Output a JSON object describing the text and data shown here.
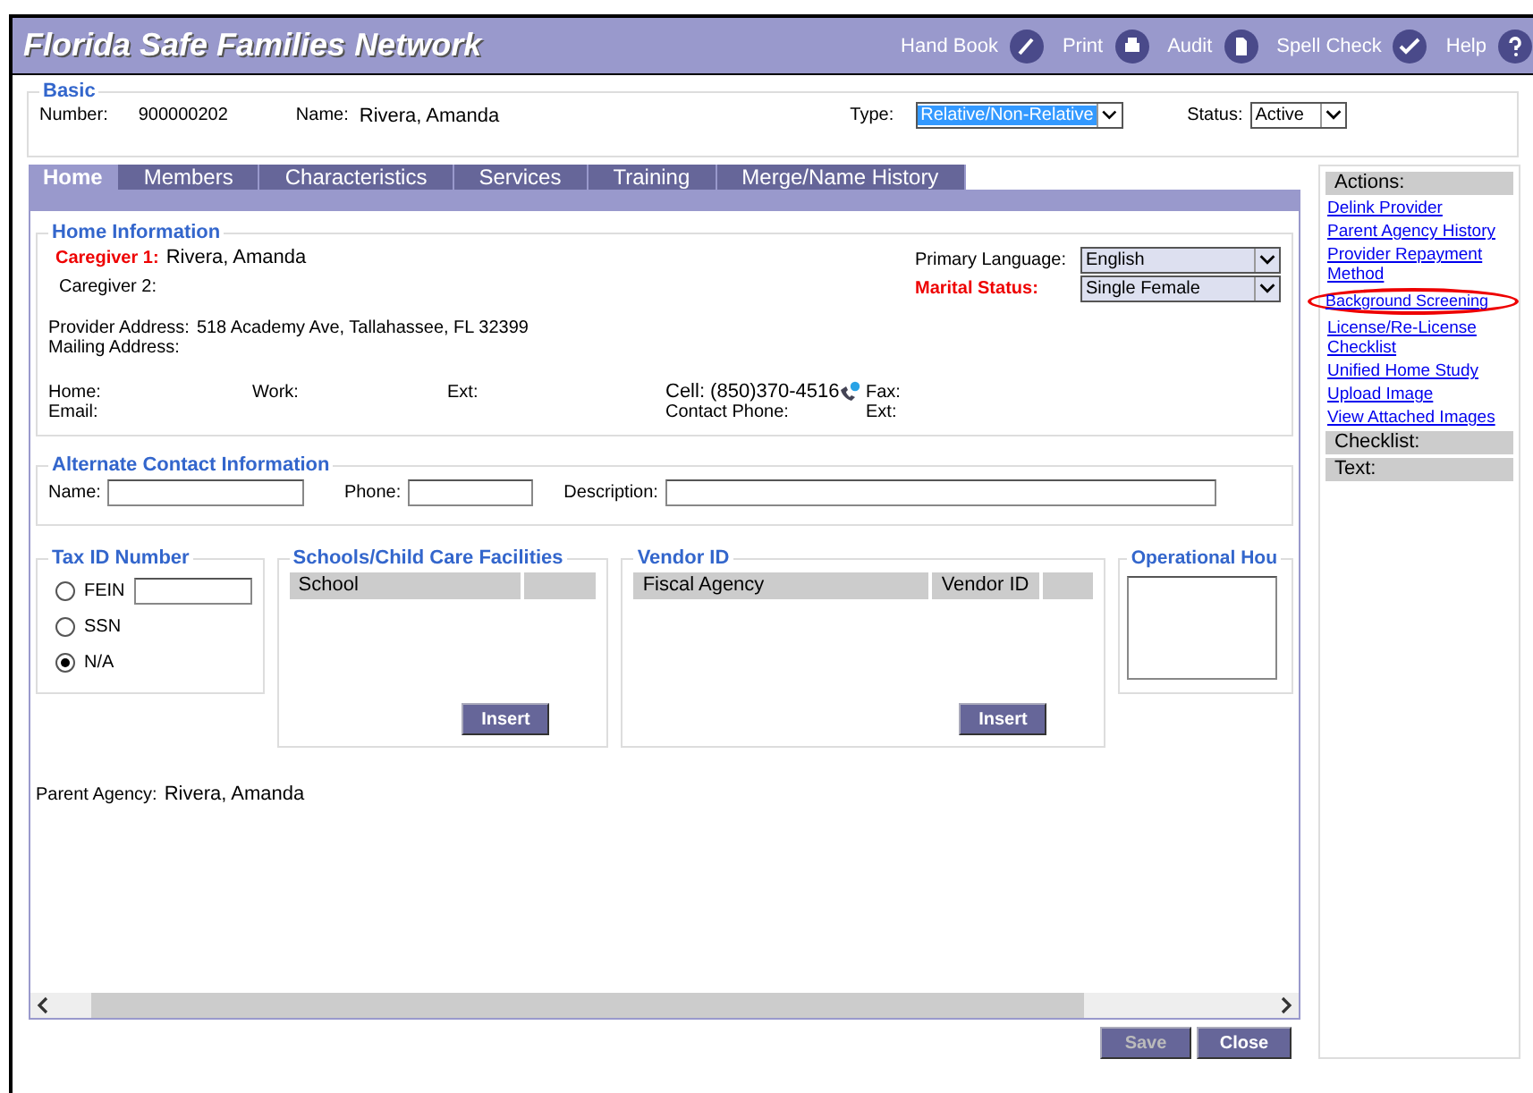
{
  "app_title": "Florida Safe Families Network",
  "header_links": [
    {
      "label": "Hand Book",
      "kind": "book"
    },
    {
      "label": "Print",
      "kind": "print"
    },
    {
      "label": "Audit",
      "kind": "audit"
    },
    {
      "label": "Spell Check",
      "kind": "spell"
    },
    {
      "label": "Help",
      "kind": "help"
    }
  ],
  "basic": {
    "legend": "Basic",
    "number_label": "Number:",
    "number": "900000202",
    "name_label": "Name:",
    "name": "Rivera, Amanda",
    "type_label": "Type:",
    "type": {
      "value": "Relative/Non-Relative",
      "focused": true
    },
    "status_label": "Status:",
    "status": {
      "value": "Active",
      "focused": false
    }
  },
  "tabs": [
    {
      "label": "Home",
      "selected": true
    },
    {
      "label": "Members",
      "selected": false
    },
    {
      "label": "Characteristics",
      "selected": false
    },
    {
      "label": "Services",
      "selected": false
    },
    {
      "label": "Training",
      "selected": false
    },
    {
      "label": "Merge/Name History",
      "selected": false
    }
  ],
  "home_info": {
    "legend": "Home Information",
    "caregiver1_label": "Caregiver 1:",
    "caregiver1": "Rivera, Amanda",
    "caregiver2_label": "Caregiver 2:",
    "language_label": "Primary Language:",
    "language": "English",
    "marital_label": "Marital Status:",
    "marital": "Single Female",
    "provider_address_label": "Provider Address:",
    "provider_address": "518 Academy Ave, Tallahassee, FL 32399",
    "mailing_address_label": "Mailing Address:",
    "home_label": "Home:",
    "work_label": "Work:",
    "ext_label": "Ext:",
    "cell": "Cell: (850)370-4516",
    "fax_label": "Fax:",
    "email_label": "Email:",
    "contact_phone_label": "Contact Phone:",
    "ext2_label": "Ext:"
  },
  "alternate_contact": {
    "legend": "Alternate Contact Information",
    "name_label": "Name:",
    "phone_label": "Phone:",
    "description_label": "Description:"
  },
  "tax_id": {
    "legend": "Tax ID Number",
    "options": [
      {
        "label": "FEIN",
        "selected": false,
        "kind": "field"
      },
      {
        "label": "SSN",
        "selected": false,
        "kind": "plain"
      },
      {
        "label": "N/A",
        "selected": true,
        "kind": "plain"
      }
    ]
  },
  "schools": {
    "legend": "Schools/Child Care Facilities",
    "columns": [
      "School",
      ""
    ],
    "button": "Insert"
  },
  "vendor": {
    "legend": "Vendor ID",
    "columns": [
      "Fiscal Agency",
      "Vendor ID",
      ""
    ],
    "button": "Insert"
  },
  "operational_hours": {
    "legend": "Operational Hou"
  },
  "parent_agency": {
    "label": "Parent Agency:",
    "value": "Rivera, Amanda"
  },
  "buttons": [
    {
      "label": "Save",
      "disabled": true
    },
    {
      "label": "Close",
      "disabled": false
    }
  ],
  "sidebar": {
    "actions_title": "Actions:",
    "actions": [
      {
        "label": "Delink Provider",
        "highlighted": false
      },
      {
        "label": "Parent Agency History",
        "highlighted": false
      },
      {
        "label": "Provider Repayment Method",
        "highlighted": false
      },
      {
        "label": "Background Screening",
        "highlighted": true
      },
      {
        "label": "License/Re-License Checklist",
        "highlighted": false
      },
      {
        "label": "Unified Home Study",
        "highlighted": false
      },
      {
        "label": "Upload Image",
        "highlighted": false
      },
      {
        "label": "View Attached Images",
        "highlighted": false
      }
    ],
    "checklist_title": "Checklist:",
    "text_title": "Text:"
  }
}
